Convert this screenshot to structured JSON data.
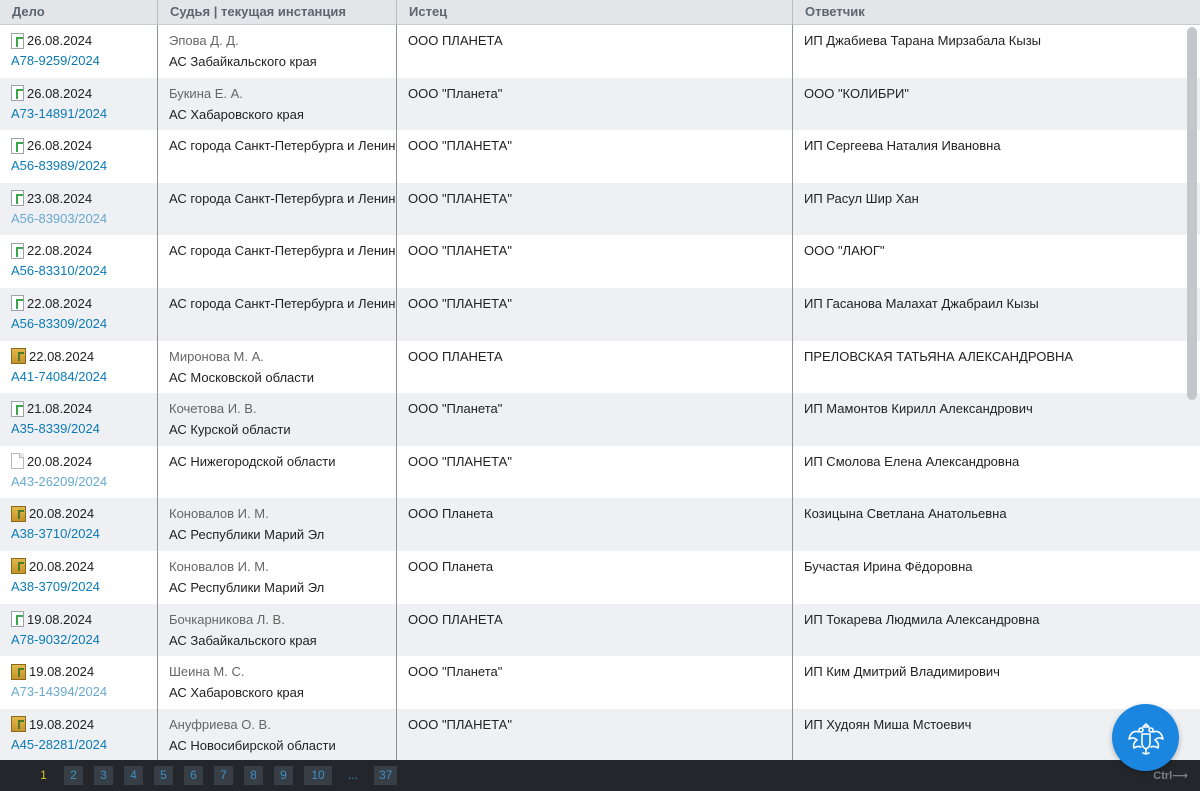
{
  "header": {
    "col_case": "Дело",
    "col_judge": "Судья | текущая инстанция",
    "col_plaintiff": "Истец",
    "col_defendant": "Ответчик"
  },
  "rows": [
    {
      "icon": "green",
      "date": "26.08.2024",
      "case": "А78-9259/2024",
      "visited": false,
      "judge": "Эпова Д. Д.",
      "court": "АС Забайкальского края",
      "plaintiff": "ООО ПЛАНЕТА",
      "defendant": "ИП Джабиева Тарана Мирзабала Кызы"
    },
    {
      "icon": "green",
      "date": "26.08.2024",
      "case": "А73-14891/2024",
      "visited": false,
      "judge": "Букина Е. А.",
      "court": "АС Хабаровского края",
      "plaintiff": "ООО \"Планета\"",
      "defendant": "ООО \"КОЛИБРИ\""
    },
    {
      "icon": "green",
      "date": "26.08.2024",
      "case": "А56-83989/2024",
      "visited": false,
      "judge": "",
      "court": "АС города Санкт-Петербурга и Ленин",
      "plaintiff": "ООО \"ПЛАНЕТА\"",
      "defendant": "ИП Сергеева Наталия Ивановна"
    },
    {
      "icon": "green",
      "date": "23.08.2024",
      "case": "А56-83903/2024",
      "visited": true,
      "judge": "",
      "court": "АС города Санкт-Петербурга и Ленин",
      "plaintiff": "ООО \"ПЛАНЕТА\"",
      "defendant": "ИП Расул Шир Хан"
    },
    {
      "icon": "green",
      "date": "22.08.2024",
      "case": "А56-83310/2024",
      "visited": false,
      "judge": "",
      "court": "АС города Санкт-Петербурга и Ленин",
      "plaintiff": "ООО \"ПЛАНЕТА\"",
      "defendant": "ООО \"ЛАЮГ\""
    },
    {
      "icon": "green",
      "date": "22.08.2024",
      "case": "А56-83309/2024",
      "visited": false,
      "judge": "",
      "court": "АС города Санкт-Петербурга и Ленин",
      "plaintiff": "ООО \"ПЛАНЕТА\"",
      "defendant": "ИП Гасанова Малахат Джабраил Кызы"
    },
    {
      "icon": "folder",
      "date": "22.08.2024",
      "case": "А41-74084/2024",
      "visited": false,
      "judge": "Миронова М. А.",
      "court": "АС Московской области",
      "plaintiff": "ООО ПЛАНЕТА",
      "defendant": "ПРЕЛОВСКАЯ ТАТЬЯНА АЛЕКСАНДРОВНА"
    },
    {
      "icon": "green",
      "date": "21.08.2024",
      "case": "А35-8339/2024",
      "visited": false,
      "judge": "Кочетова И. В.",
      "court": "АС Курской области",
      "plaintiff": "ООО \"Планета\"",
      "defendant": "ИП Мамонтов Кирилл Александрович"
    },
    {
      "icon": "plain",
      "date": "20.08.2024",
      "case": "А43-26209/2024",
      "visited": true,
      "judge": "",
      "court": "АС Нижегородской области",
      "plaintiff": "ООО \"ПЛАНЕТА\"",
      "defendant": "ИП Смолова Елена Александровна"
    },
    {
      "icon": "folder",
      "date": "20.08.2024",
      "case": "А38-3710/2024",
      "visited": false,
      "judge": "Коновалов И. М.",
      "court": "АС Республики Марий Эл",
      "plaintiff": "ООО Планета",
      "defendant": "Козицына Светлана Анатольевна"
    },
    {
      "icon": "folder",
      "date": "20.08.2024",
      "case": "А38-3709/2024",
      "visited": false,
      "judge": "Коновалов И. М.",
      "court": "АС Республики Марий Эл",
      "plaintiff": "ООО Планета",
      "defendant": "Бучастая Ирина Фёдоровна"
    },
    {
      "icon": "green",
      "date": "19.08.2024",
      "case": "А78-9032/2024",
      "visited": false,
      "judge": "Бочкарникова Л. В.",
      "court": "АС Забайкальского края",
      "plaintiff": "ООО ПЛАНЕТА",
      "defendant": "ИП Токарева Людмила Александровна"
    },
    {
      "icon": "folder",
      "date": "19.08.2024",
      "case": "А73-14394/2024",
      "visited": true,
      "judge": "Шеина М. С.",
      "court": "АС Хабаровского края",
      "plaintiff": "ООО \"Планета\"",
      "defendant": "ИП Ким Дмитрий Владимирович"
    },
    {
      "icon": "folder",
      "date": "19.08.2024",
      "case": "А45-28281/2024",
      "visited": false,
      "judge": "Ануфриева О. В.",
      "court": "АС Новосибирской области",
      "plaintiff": "ООО \"ПЛАНЕТА\"",
      "defendant": "ИП Худоян Миша Мстоевич"
    }
  ],
  "pagination": {
    "current": "1",
    "pages": [
      "2",
      "3",
      "4",
      "5",
      "6",
      "7",
      "8",
      "9",
      "10"
    ],
    "ellipsis": "...",
    "last": "37",
    "hint": "Ctrl⟶"
  },
  "colors": {
    "link": "#0b7bb5",
    "link_visited": "#6aa9cf",
    "row_alt": "#eef0f3",
    "pager_bg": "#23272c",
    "pager_current": "#d8c21d",
    "fab": "#1a86e0"
  },
  "icons": {
    "fab": "eagle-emblem-icon"
  }
}
